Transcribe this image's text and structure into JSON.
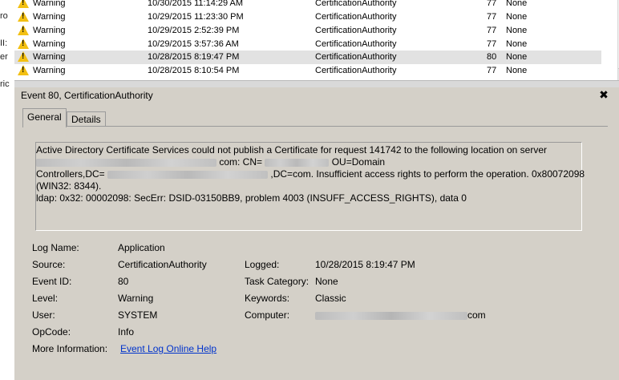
{
  "left_sliver": {
    "fragments": [
      "ro",
      "II:",
      "er",
      "ric"
    ]
  },
  "events": [
    {
      "level": "Warning",
      "date": "10/30/2015 11:14:29 AM",
      "source": "CertificationAuthority",
      "event_id": "77",
      "task": "None"
    },
    {
      "level": "Warning",
      "date": "10/29/2015 11:23:30 PM",
      "source": "CertificationAuthority",
      "event_id": "77",
      "task": "None"
    },
    {
      "level": "Warning",
      "date": "10/29/2015 2:52:39 PM",
      "source": "CertificationAuthority",
      "event_id": "77",
      "task": "None"
    },
    {
      "level": "Warning",
      "date": "10/29/2015 3:57:36 AM",
      "source": "CertificationAuthority",
      "event_id": "77",
      "task": "None"
    },
    {
      "level": "Warning",
      "date": "10/28/2015 8:19:47 PM",
      "source": "CertificationAuthority",
      "event_id": "80",
      "task": "None",
      "selected": true
    },
    {
      "level": "Warning",
      "date": "10/28/2015 8:10:54 PM",
      "source": "CertificationAuthority",
      "event_id": "77",
      "task": "None"
    }
  ],
  "detail": {
    "title": "Event 80, CertificationAuthority",
    "close_glyph": "✖",
    "tabs": [
      {
        "label": "General",
        "active": true
      },
      {
        "label": "Details",
        "active": false
      }
    ],
    "description": {
      "line1": "Active Directory Certificate Services could not publish a Certificate for request 141742 to the following location on server",
      "line2_suffix": "com: CN=",
      "line2_suffix2": "OU=Domain",
      "line3_prefix": "Controllers,DC=",
      "line3_suffix": ",DC=com.  Insufficient access rights to perform the operation. 0x80072098",
      "line4": "(WIN32: 8344).",
      "line5": "ldap: 0x32: 00002098: SecErr: DSID-03150BB9, problem 4003 (INSUFF_ACCESS_RIGHTS), data 0"
    },
    "properties": {
      "log_name_label": "Log Name:",
      "log_name": "Application",
      "source_label": "Source:",
      "source": "CertificationAuthority",
      "logged_label": "Logged:",
      "logged": "10/28/2015 8:19:47 PM",
      "event_id_label": "Event ID:",
      "event_id": "80",
      "task_category_label": "Task Category:",
      "task_category": "None",
      "level_label": "Level:",
      "level": "Warning",
      "keywords_label": "Keywords:",
      "keywords": "Classic",
      "user_label": "User:",
      "user": "SYSTEM",
      "computer_label": "Computer:",
      "computer_suffix": "com",
      "opcode_label": "OpCode:",
      "opcode": "Info",
      "more_info_label": "More Information:",
      "more_info_link": "Event Log Online Help"
    }
  },
  "colors": {
    "warning": "#f3c012",
    "selected_row": "#e2e2e2",
    "panel": "#d4d0c8",
    "link": "#0033cc"
  }
}
